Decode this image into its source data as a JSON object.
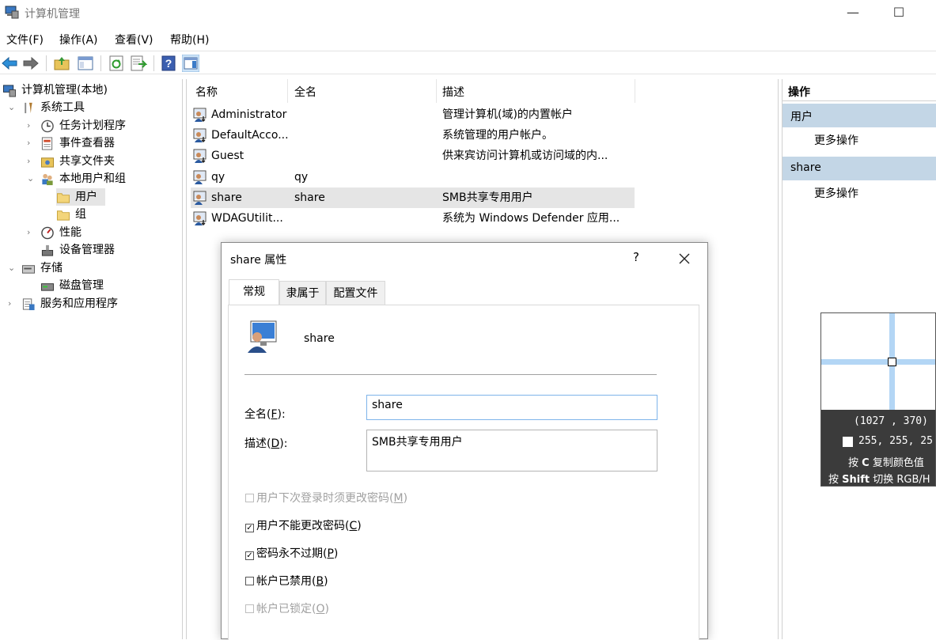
{
  "window": {
    "title": "计算机管理",
    "minimize_glyph": "—",
    "maximize_glyph": "☐"
  },
  "menu": [
    "文件(F)",
    "操作(A)",
    "查看(V)",
    "帮助(H)"
  ],
  "toolbar": {
    "icons": [
      "back-arrow-icon",
      "forward-arrow-icon",
      "up-folder-icon",
      "show-hide-tree-icon",
      "refresh-icon",
      "export-list-icon",
      "help-icon",
      "show-hide-action-pane-icon"
    ]
  },
  "tree": {
    "root": "计算机管理(本地)",
    "system_tools": "系统工具",
    "task_scheduler": "任务计划程序",
    "event_viewer": "事件查看器",
    "shared_folders": "共享文件夹",
    "local_users_groups": "本地用户和组",
    "users": "用户",
    "groups": "组",
    "performance": "性能",
    "device_manager": "设备管理器",
    "storage": "存储",
    "disk_management": "磁盘管理",
    "services_apps": "服务和应用程序"
  },
  "list": {
    "headers": {
      "name": "名称",
      "fullname": "全名",
      "description": "描述"
    },
    "rows": [
      {
        "name": "Administrator",
        "fullname": "",
        "description": "管理计算机(域)的内置帐户"
      },
      {
        "name": "DefaultAcco...",
        "fullname": "",
        "description": "系统管理的用户帐户。"
      },
      {
        "name": "Guest",
        "fullname": "",
        "description": "供来宾访问计算机或访问域的内..."
      },
      {
        "name": "qy",
        "fullname": "qy",
        "description": ""
      },
      {
        "name": "share",
        "fullname": "share",
        "description": "SMB共享专用用户"
      },
      {
        "name": "WDAGUtilit...",
        "fullname": "",
        "description": "系统为 Windows Defender 应用..."
      }
    ]
  },
  "actions": {
    "header": "操作",
    "section1": "用户",
    "more1": "更多操作",
    "section2": "share",
    "more2": "更多操作"
  },
  "dialog": {
    "title": "share 属性",
    "help_glyph": "?",
    "tabs": [
      "常规",
      "隶属于",
      "配置文件"
    ],
    "username": "share",
    "fullname_label_pre": "全名(",
    "fullname_label_key": "F",
    "fullname_label_post": "):",
    "fullname_value": "share",
    "desc_label_pre": "描述(",
    "desc_label_key": "D",
    "desc_label_post": "):",
    "desc_value": "SMB共享专用用户",
    "checkboxes": [
      {
        "pre": "用户下次登录时须更改密码(",
        "key": "M",
        "post": ")",
        "checked": false,
        "disabled": true
      },
      {
        "pre": "用户不能更改密码(",
        "key": "C",
        "post": ")",
        "checked": true,
        "disabled": false
      },
      {
        "pre": "密码永不过期(",
        "key": "P",
        "post": ")",
        "checked": true,
        "disabled": false
      },
      {
        "pre": "帐户已禁用(",
        "key": "B",
        "post": ")",
        "checked": false,
        "disabled": false
      },
      {
        "pre": "帐户已锁定(",
        "key": "O",
        "post": ")",
        "checked": false,
        "disabled": true
      }
    ]
  },
  "color_picker": {
    "coords": "(1027 , 370)",
    "rgb": "255, 255, 25",
    "hint1_pre": "按 ",
    "hint1_key": "C",
    "hint1_post": " 复制颜色值",
    "hint2_pre": "按 ",
    "hint2_key": "Shift",
    "hint2_post": " 切换 RGB/H",
    "swatch_color": "#ffffff"
  },
  "colors": {
    "action_section_bg": "#c3d6e6",
    "selection_bg": "#e5e5e5",
    "picker_crosshair": "#b3d6f5"
  }
}
